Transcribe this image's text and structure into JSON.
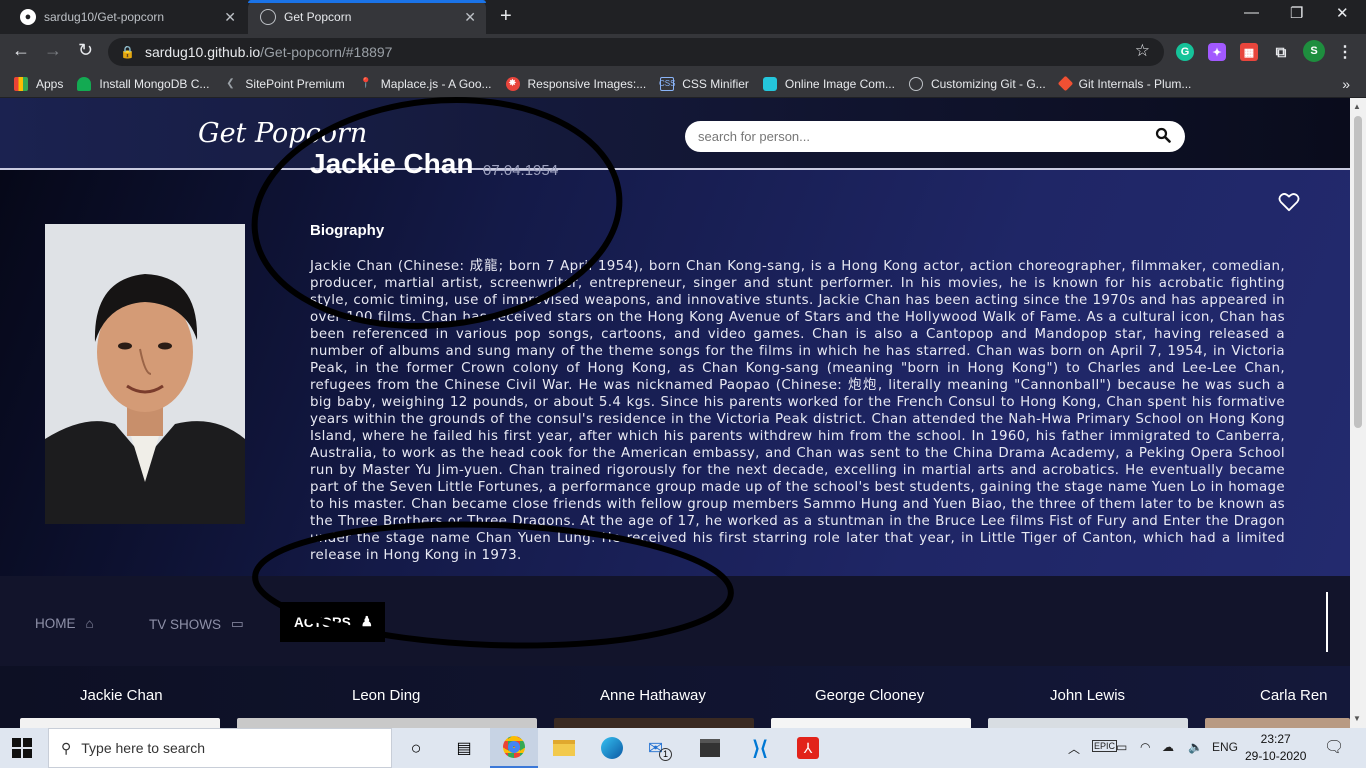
{
  "browser": {
    "tabs": [
      {
        "title": "sardug10/Get-popcorn",
        "active": false
      },
      {
        "title": "Get Popcorn",
        "active": true
      }
    ],
    "url_host": "sardug10.github.io",
    "url_path": "/Get-popcorn/#18897",
    "bookmarks": [
      {
        "label": "Apps",
        "icon": "apps-grid-icon"
      },
      {
        "label": "Install MongoDB C...",
        "icon": "mongodb-leaf-icon"
      },
      {
        "label": "SitePoint Premium",
        "icon": "sitepoint-icon"
      },
      {
        "label": "Maplace.js - A Goo...",
        "icon": "map-pin-icon"
      },
      {
        "label": "Responsive Images:...",
        "icon": "responsive-images-icon"
      },
      {
        "label": "CSS Minifier",
        "icon": "css-icon"
      },
      {
        "label": "Online Image Com...",
        "icon": "image-compress-icon"
      },
      {
        "label": "Customizing Git - G...",
        "icon": "globe-icon"
      },
      {
        "label": "Git Internals - Plum...",
        "icon": "git-icon"
      }
    ],
    "profile_initial": "S"
  },
  "site": {
    "logo": "Get Popcorn",
    "search_placeholder": "search for person..."
  },
  "person": {
    "name": "Jackie Chan",
    "dob": "07.04.1954",
    "bio_heading": "Biography",
    "bio": "Jackie Chan (Chinese: 成龍; born 7 April 1954), born Chan Kong-sang, is a Hong Kong actor, action choreographer, filmmaker, comedian, producer, martial artist, screenwriter, entrepreneur, singer and stunt performer. In his movies, he is known for his acrobatic fighting style, comic timing, use of improvised weapons, and innovative stunts. Jackie Chan has been acting since the 1970s and has appeared in over 100 films. Chan has received stars on the Hong Kong Avenue of Stars and the Hollywood Walk of Fame. As a cultural icon, Chan has been referenced in various pop songs, cartoons, and video games. Chan is also a Cantopop and Mandopop star, having released a number of albums and sung many of the theme songs for the films in which he has starred. Chan was born on April 7, 1954, in Victoria Peak, in the former Crown colony of Hong Kong, as Chan Kong-sang (meaning \"born in Hong Kong\") to Charles and Lee-Lee Chan, refugees from the Chinese Civil War. He was nicknamed Paopao (Chinese: 炮炮, literally meaning \"Cannonball\") because he was such a big baby, weighing 12 pounds, or about 5.4 kgs. Since his parents worked for the French Consul to Hong Kong, Chan spent his formative years within the grounds of the consul's residence in the Victoria Peak district. Chan attended the Nah-Hwa Primary School on Hong Kong Island, where he failed his first year, after which his parents withdrew him from the school. In 1960, his father immigrated to Canberra, Australia, to work as the head cook for the American embassy, and Chan was sent to the China Drama Academy, a Peking Opera School run by Master Yu Jim-yuen. Chan trained rigorously for the next decade, excelling in martial arts and acrobatics. He eventually became part of the Seven Little Fortunes, a performance group made up of the school's best students, gaining the stage name Yuen Lo in homage to his master. Chan became close friends with fellow group members Sammo Hung and Yuen Biao, the three of them later to be known as the Three Brothers or Three Dragons. At the age of 17, he worked as a stuntman in the Bruce Lee films Fist of Fury and Enter the Dragon under the stage name Chan Yuen Lung.   He received his first starring role later that year, in Little Tiger of Canton, which had a limited release in Hong Kong in 1973."
  },
  "nav": {
    "home": "HOME",
    "tv_shows": "TV SHOWS",
    "actors": "ACTORS"
  },
  "people": [
    {
      "name": "Jackie Chan"
    },
    {
      "name": "Leon Ding"
    },
    {
      "name": "Anne Hathaway"
    },
    {
      "name": "George Clooney"
    },
    {
      "name": "John Lewis"
    },
    {
      "name": "Carla Ren"
    }
  ],
  "taskbar": {
    "search_placeholder": "Type here to search",
    "language": "ENG",
    "time": "23:27",
    "date": "29-10-2020",
    "mail_badge": "1"
  },
  "colors": {
    "accent": "#1a73e8",
    "chrome_dark": "#202124",
    "annotation": "#000000"
  }
}
